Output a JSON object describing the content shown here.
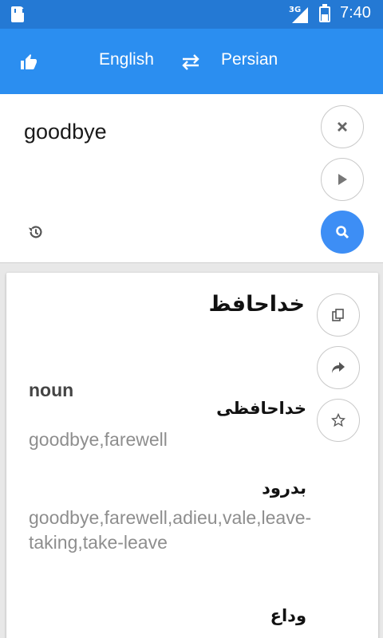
{
  "status_bar": {
    "network": "3G",
    "time": "7:40"
  },
  "app_bar": {
    "source_language": "English",
    "target_language": "Persian",
    "icons": [
      "thumbs-up-icon",
      "swap-icon"
    ]
  },
  "input": {
    "text": "goodbye",
    "icons": [
      "close-icon",
      "play-icon",
      "history-icon",
      "search-icon"
    ]
  },
  "result": {
    "main_translation": "خداحافظ",
    "icons": [
      "copy-icon",
      "share-icon",
      "star-icon"
    ],
    "part_of_speech": "noun",
    "entries": [
      {
        "word": "خداحافظی",
        "synonyms": "goodbye,farewell"
      },
      {
        "word": "بدرود",
        "synonyms": "goodbye,farewell,adieu,vale,leave-taking,take-leave"
      },
      {
        "word": "وداع",
        "synonyms": ""
      }
    ]
  },
  "colors": {
    "status_bar": "#2479d4",
    "app_bar": "#2b8ef0",
    "search_button": "#3d8ef5",
    "synonym_text": "#8e8e8e"
  }
}
